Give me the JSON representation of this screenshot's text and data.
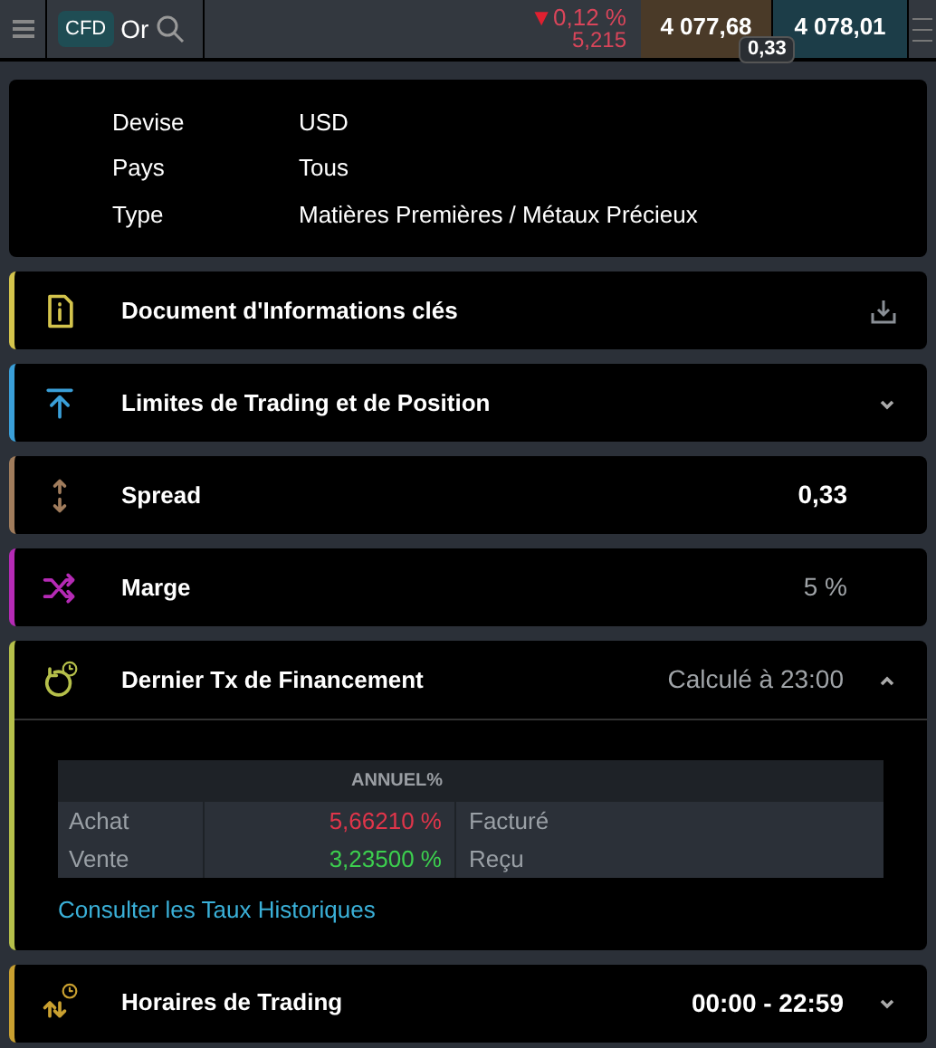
{
  "topbar": {
    "badge": "CFD",
    "instrument": "Or",
    "change_arrow": "▼",
    "change_pct": "0,12 %",
    "change_abs": "5,215",
    "sell": "4 077,68",
    "buy": "4 078,01",
    "spread": "0,33"
  },
  "info": [
    {
      "label": "Devise",
      "value": "USD"
    },
    {
      "label": "Pays",
      "value": "Tous"
    },
    {
      "label": "Type",
      "value": "Matières Premières / Métaux Précieux"
    }
  ],
  "sections": [
    {
      "kind": "info",
      "title": "Document d'Informations clés",
      "color": "#d4c44c",
      "downloadable": true
    },
    {
      "kind": "limits",
      "title": "Limites de Trading et de Position",
      "color": "#3a9fd8",
      "expanded": false
    },
    {
      "kind": "spread",
      "title": "Spread",
      "color": "#a07c5c",
      "value": "0,33",
      "value_bold": true
    },
    {
      "kind": "margin",
      "title": "Marge",
      "color": "#b52ab5",
      "value": "5 %",
      "value_bold": false
    },
    {
      "kind": "financing",
      "title": "Dernier Tx de Financement",
      "color": "#b5bf4a",
      "value": "Calculé à 23:00",
      "value_bold": false,
      "expanded": true,
      "table": {
        "header": "ANNUEL%",
        "rows": [
          {
            "label": "Achat",
            "value": "5,66210 %",
            "color": "#e0354a",
            "note": "Facturé"
          },
          {
            "label": "Vente",
            "value": "3,23500 %",
            "color": "#3ccf4e",
            "note": "Reçu"
          }
        ]
      },
      "link": "Consulter les Taux Historiques"
    },
    {
      "kind": "hours",
      "title": "Horaires de Trading",
      "color": "#c9a030",
      "value": "00:00 - 22:59",
      "value_bold": true,
      "expanded": false
    }
  ]
}
